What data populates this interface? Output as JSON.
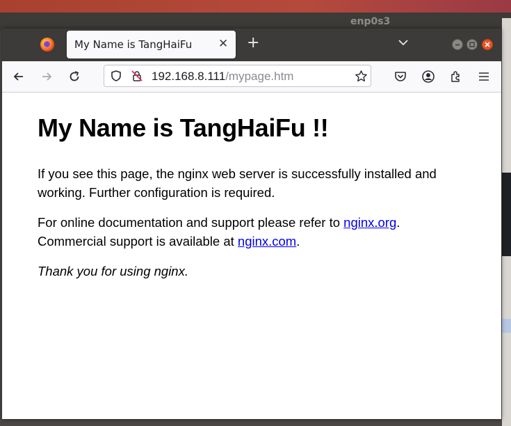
{
  "desktop": {
    "background_window_title": "enp0s3"
  },
  "browser": {
    "tab": {
      "title": "My Name is TangHaiFu",
      "close_glyph": "✕"
    },
    "new_tab_glyph": "+",
    "url": {
      "host": "192.168.8.111",
      "path": "/mypage.htm"
    },
    "icons": {
      "back": "back-arrow-icon",
      "forward": "forward-arrow-icon",
      "reload": "reload-icon",
      "shield": "tracking-shield-icon",
      "insecure": "insecure-lock-icon",
      "bookmark": "star-icon",
      "pocket": "pocket-icon",
      "account": "account-icon",
      "extensions": "extensions-icon",
      "menu": "hamburger-menu-icon"
    },
    "colors": {
      "tabbar": "#3d3b39",
      "close_button": "#e95420",
      "link": "#0000ee"
    }
  },
  "page": {
    "heading": "My Name is TangHaiFu !!",
    "paragraph1": "If you see this page, the nginx web server is successfully installed and working. Further configuration is required.",
    "paragraph2_prefix": "For online documentation and support please refer to ",
    "link1": "nginx.org",
    "paragraph2_mid": ". Commercial support is available at ",
    "link2": "nginx.com",
    "paragraph2_suffix": ".",
    "paragraph3": "Thank you for using nginx."
  }
}
